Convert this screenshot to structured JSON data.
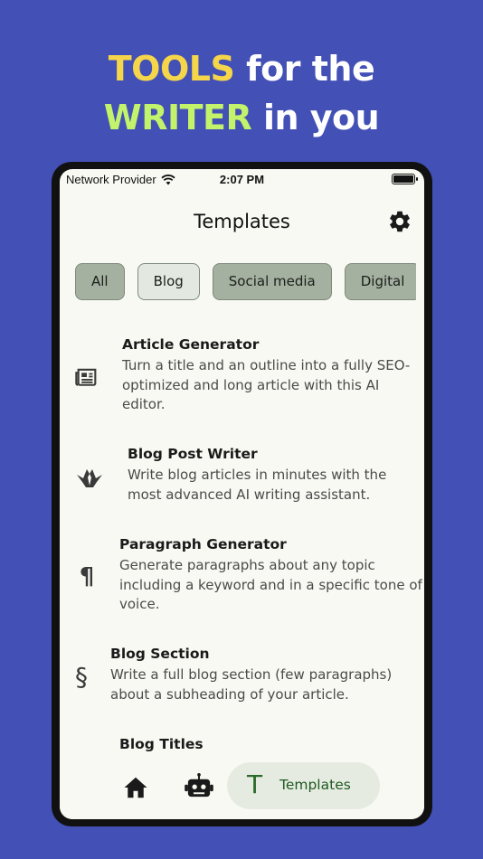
{
  "headline": {
    "line1_highlight": "TOOLS",
    "line1_rest": " for the",
    "line2_highlight": "WRITER",
    "line2_rest": " in you"
  },
  "status_bar": {
    "carrier": "Network Provider",
    "time": "2:07 PM",
    "icons": [
      "wifi-icon",
      "battery-icon"
    ]
  },
  "app_bar": {
    "title": "Templates",
    "settings_icon": "gear-icon"
  },
  "filters": {
    "chips": [
      {
        "label": "All",
        "selected": false
      },
      {
        "label": "Blog",
        "selected": true
      },
      {
        "label": "Social media",
        "selected": false
      },
      {
        "label": "Digital",
        "selected": false
      }
    ]
  },
  "templates": [
    {
      "icon": "newspaper-icon",
      "title": "Article Generator",
      "description": "Turn a title and an outline into a fully SEO-optimized and long article with this AI editor."
    },
    {
      "icon": "origami-bird-icon",
      "title": "Blog Post Writer",
      "description": "Write blog articles in minutes with the most advanced AI writing assistant."
    },
    {
      "icon": "pilcrow-icon",
      "title": "Paragraph Generator",
      "description": "Generate paragraphs about any topic including a keyword and in a specific tone of voice."
    },
    {
      "icon": "section-sign-icon",
      "title": "Blog Section",
      "description": "Write a full blog section (few paragraphs) about a subheading of your article."
    },
    {
      "icon": "",
      "title": "Blog Titles",
      "description": ""
    }
  ],
  "bottom_nav": {
    "items": [
      {
        "icon": "home-icon",
        "label": ""
      },
      {
        "icon": "robot-icon",
        "label": ""
      },
      {
        "icon": "templates-t-icon",
        "label": "Templates",
        "active": true
      }
    ],
    "t_glyph": "T"
  },
  "colors": {
    "background": "#4350b5",
    "highlight_yellow": "#f5d54a",
    "highlight_green": "#c3f36a",
    "chip": "#a4b1a1",
    "chip_selected": "#e3e8e0",
    "nav_active_bg": "#e6ebe2"
  }
}
